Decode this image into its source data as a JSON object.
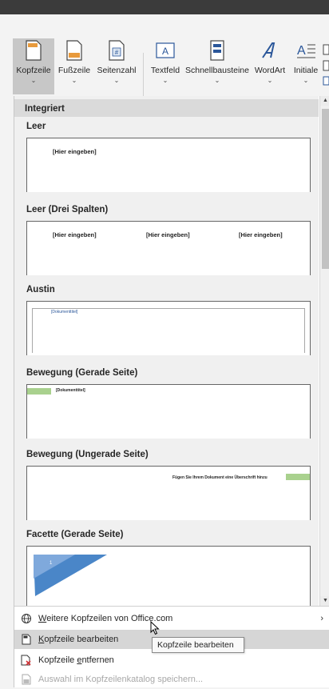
{
  "ribbon": {
    "buttons": [
      {
        "label": "Kopfzeile",
        "icon": "header-icon"
      },
      {
        "label": "Fußzeile",
        "icon": "footer-icon"
      },
      {
        "label": "Seitenzahl",
        "icon": "page-number-icon"
      },
      {
        "label": "Textfeld",
        "icon": "textbox-icon"
      },
      {
        "label": "Schnellbausteine",
        "icon": "quick-parts-icon"
      },
      {
        "label": "WordArt",
        "icon": "wordart-icon"
      },
      {
        "label": "Initiale",
        "icon": "dropcap-icon"
      }
    ],
    "chevron": "⌄"
  },
  "gallery": {
    "section": "Integriert",
    "items": [
      {
        "title": "Leer",
        "placeholders": [
          "[Hier eingeben]"
        ]
      },
      {
        "title": "Leer (Drei Spalten)",
        "placeholders": [
          "[Hier eingeben]",
          "[Hier eingeben]",
          "[Hier eingeben]"
        ]
      },
      {
        "title": "Austin",
        "placeholders": [
          "[Dokumenttitel]"
        ]
      },
      {
        "title": "Bewegung (Gerade Seite)",
        "placeholders": [
          "[Dokumenttitel]"
        ]
      },
      {
        "title": "Bewegung (Ungerade Seite)",
        "placeholders": [
          "Fügen Sie Ihrem Dokument eine Überschrift hinzu"
        ]
      },
      {
        "title": "Facette (Gerade Seite)",
        "placeholders": [
          "1"
        ]
      }
    ]
  },
  "menu": {
    "more_prefix": "W",
    "more_rest": "eitere Kopfzeilen von Office.com",
    "edit_prefix": "K",
    "edit_rest": "opfzeile bearbeiten",
    "remove_prefix": "Kopfzeile ",
    "remove_u": "e",
    "remove_rest": "ntfernen",
    "save_label": "Auswahl im Kopfzeilenkatalog speichern..."
  },
  "tooltip": "Kopfzeile bearbeiten",
  "colors": {
    "accent": "#2b579a",
    "bewegung_green": "#a9d18e",
    "facette_blue": "#4a86c8"
  }
}
